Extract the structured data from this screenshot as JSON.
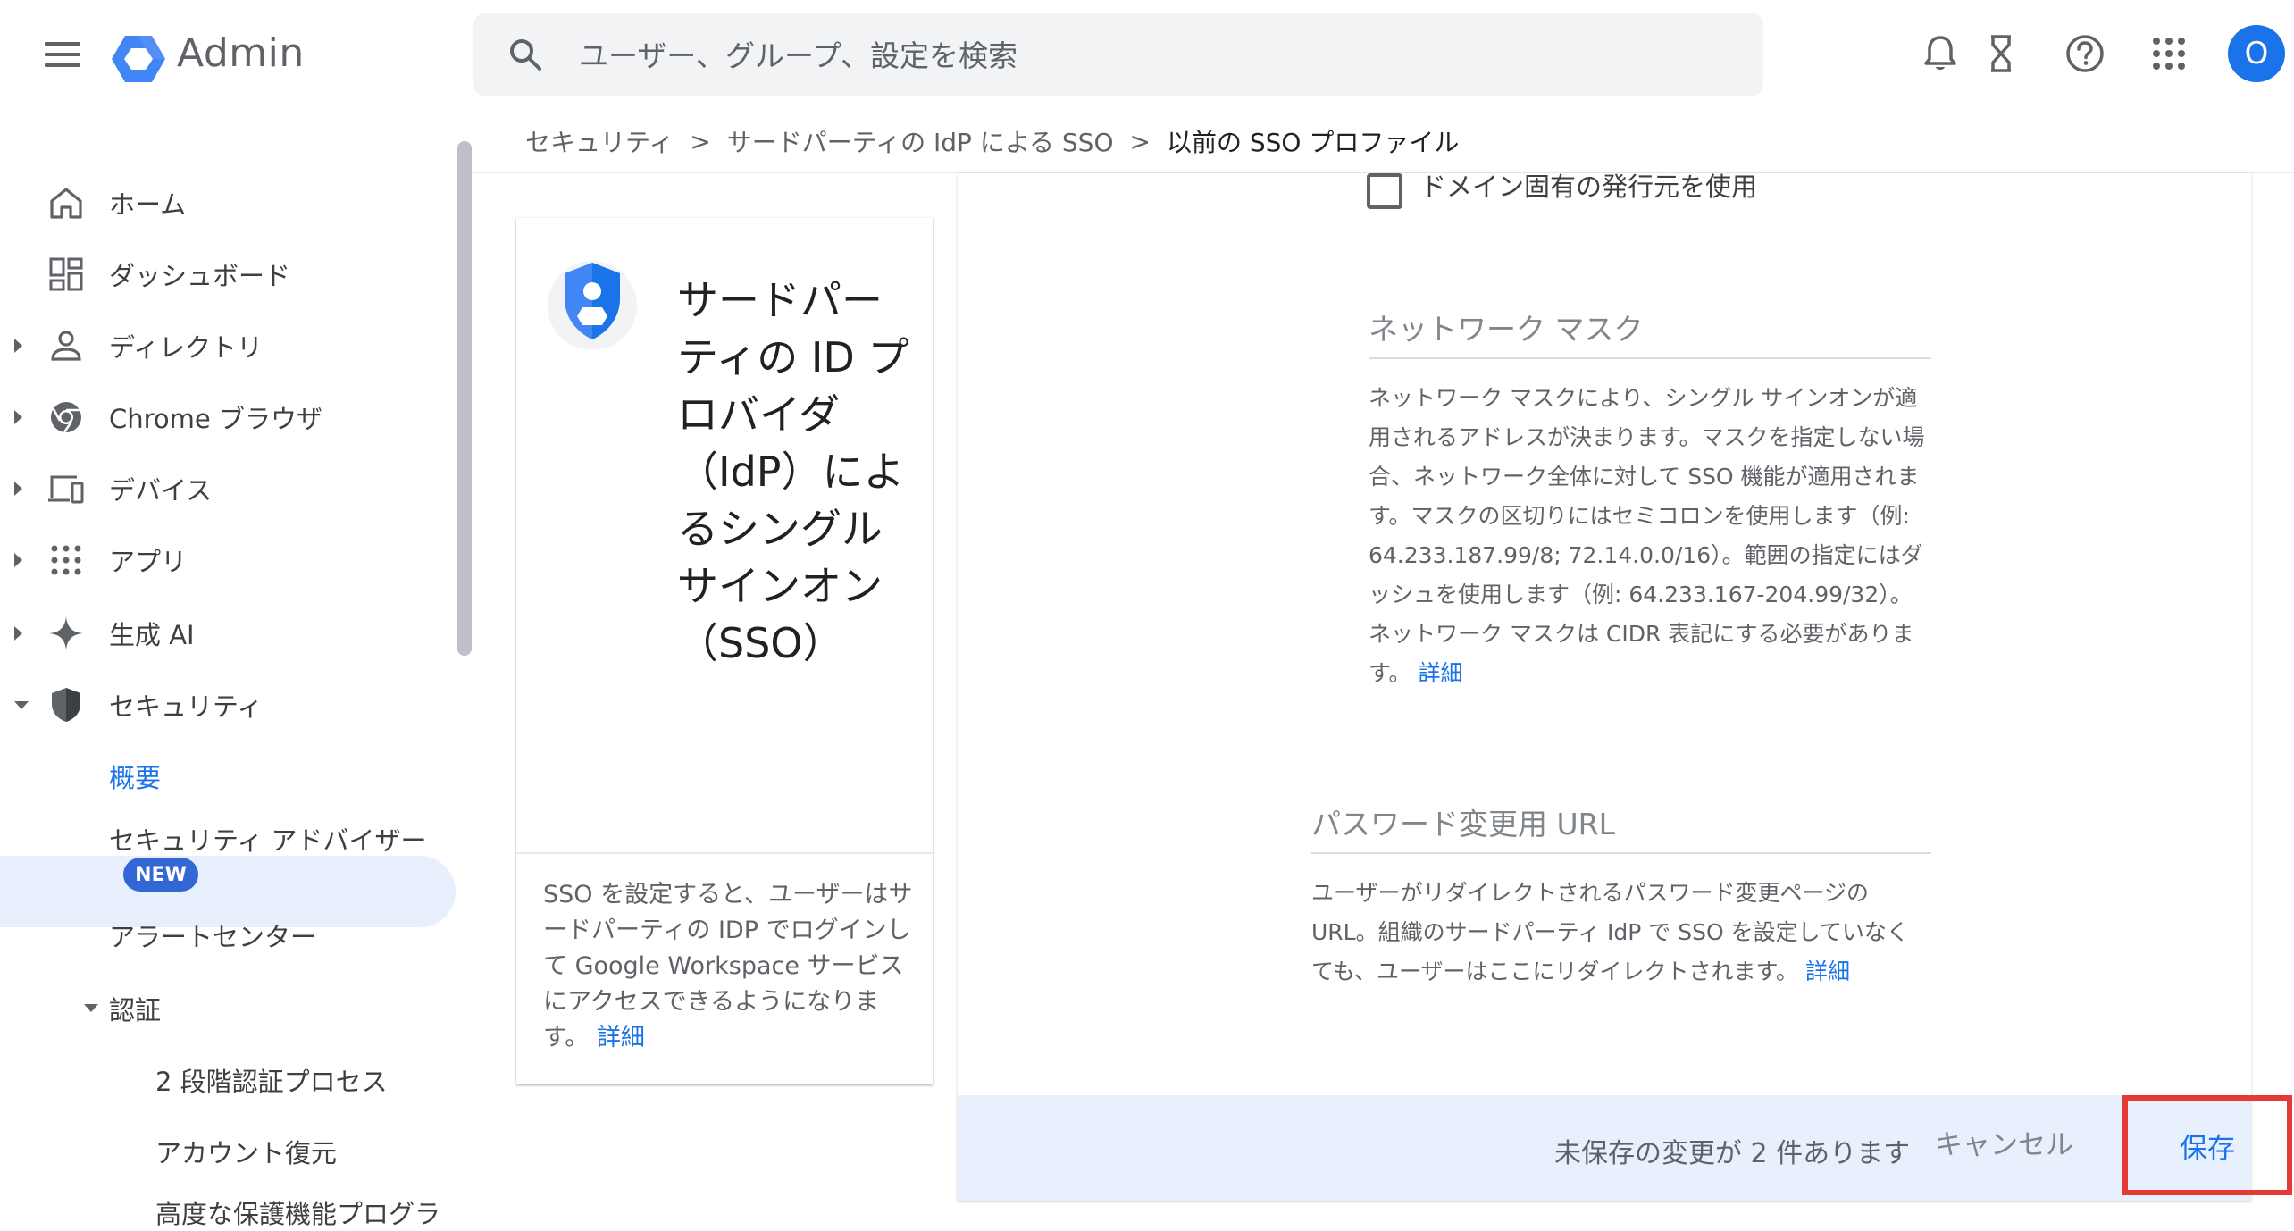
{
  "app": {
    "title": "Admin"
  },
  "search": {
    "placeholder": "ユーザー、グループ、設定を検索"
  },
  "header": {
    "avatar_initial": "O"
  },
  "breadcrumb": {
    "items": [
      "セキュリティ",
      "サードパーティの IdP による SSO",
      "以前の SSO プロファイル"
    ],
    "separator": ">"
  },
  "sidebar": {
    "items": [
      {
        "label": "ホーム",
        "icon": "home-icon"
      },
      {
        "label": "ダッシュボード",
        "icon": "dashboard-icon"
      },
      {
        "label": "ディレクトリ",
        "icon": "person-icon"
      },
      {
        "label": "Chrome ブラウザ",
        "icon": "chrome-icon"
      },
      {
        "label": "デバイス",
        "icon": "devices-icon"
      },
      {
        "label": "アプリ",
        "icon": "apps-icon"
      },
      {
        "label": "生成 AI",
        "icon": "sparkle-icon"
      },
      {
        "label": "セキュリティ",
        "icon": "shield-icon"
      }
    ],
    "security_children": {
      "overview": "概要",
      "advisor": "セキュリティ アドバイザー",
      "new_badge": "NEW",
      "alert_center": "アラートセンター",
      "auth": "認証",
      "auth_children": [
        "2 段階認証プロセス",
        "アカウント復元",
        "高度な保護機能プログラ"
      ]
    }
  },
  "card": {
    "title": "サードパーティの ID プロバイダ（IdP）によるシングル サインオン（SSO）",
    "desc": "SSO を設定すると、ユーザーはサードパーティの IDP でログインして Google Workspace サービスにアクセスできるようになります。",
    "link": "詳細"
  },
  "form": {
    "checkbox_label": "ドメイン固有の発行元を使用",
    "checkbox_checked": false,
    "network_mask": {
      "label": "ネットワーク マスク",
      "value": "",
      "desc": "ネットワーク マスクにより、シングル サインオンが適用されるアドレスが決まります。マスクを指定しない場合、ネットワーク全体に対して SSO 機能が適用されます。マスクの区切りにはセミコロンを使用します（例: 64.233.187.99/8; 72.14.0.0/16）。範囲の指定にはダッシュを使用します（例: 64.233.167-204.99/32）。ネットワーク マスクは CIDR 表記にする必要があります。",
      "link": "詳細"
    },
    "password_url": {
      "label": "パスワード変更用 URL",
      "value": "",
      "desc": "ユーザーがリダイレクトされるパスワード変更ページの URL。組織のサードパーティ IdP で SSO を設定していなくても、ユーザーはここにリダイレクトされます。",
      "link": "詳細"
    }
  },
  "savebar": {
    "message": "未保存の変更が 2 件あります",
    "cancel_label": "キャンセル",
    "save_label": "保存"
  },
  "colors": {
    "accent": "#1a73e8",
    "highlight_border": "#e53935",
    "savebar_bg": "#e8f0fe"
  }
}
